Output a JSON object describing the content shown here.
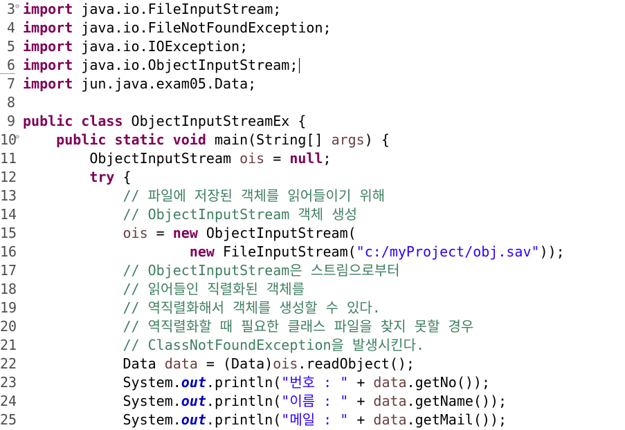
{
  "editor": {
    "lines": [
      {
        "num": "3",
        "fold": "⊖",
        "parts": [
          {
            "t": "import",
            "c": "kw"
          },
          {
            "t": " java.io.FileInputStream;",
            "c": ""
          }
        ]
      },
      {
        "num": "4",
        "fold": "",
        "parts": [
          {
            "t": "import",
            "c": "kw"
          },
          {
            "t": " java.io.FileNotFoundException;",
            "c": ""
          }
        ]
      },
      {
        "num": "5",
        "fold": "",
        "parts": [
          {
            "t": "import",
            "c": "kw"
          },
          {
            "t": " java.io.IOException;",
            "c": ""
          }
        ]
      },
      {
        "num": "6",
        "fold": "",
        "parts": [
          {
            "t": "import",
            "c": "kw"
          },
          {
            "t": " java.io.ObjectInputStream;",
            "c": ""
          }
        ]
      },
      {
        "num": "7",
        "fold": "",
        "parts": [
          {
            "t": "import",
            "c": "kw"
          },
          {
            "t": " jun.java.exam05.Data;",
            "c": ""
          }
        ]
      },
      {
        "num": "8",
        "fold": "",
        "parts": []
      },
      {
        "num": "9",
        "fold": "",
        "parts": [
          {
            "t": "public",
            "c": "kw"
          },
          {
            "t": " ",
            "c": ""
          },
          {
            "t": "class",
            "c": "kw"
          },
          {
            "t": " ObjectInputStreamEx {",
            "c": ""
          }
        ]
      },
      {
        "num": "10",
        "fold": "⊖",
        "parts": [
          {
            "t": "    ",
            "c": ""
          },
          {
            "t": "public",
            "c": "kw"
          },
          {
            "t": " ",
            "c": ""
          },
          {
            "t": "static",
            "c": "kw"
          },
          {
            "t": " ",
            "c": ""
          },
          {
            "t": "void",
            "c": "kw"
          },
          {
            "t": " main(String[] ",
            "c": ""
          },
          {
            "t": "args",
            "c": "var"
          },
          {
            "t": ") {",
            "c": ""
          }
        ]
      },
      {
        "num": "11",
        "fold": "",
        "parts": [
          {
            "t": "        ObjectInputStream ",
            "c": ""
          },
          {
            "t": "ois",
            "c": "var"
          },
          {
            "t": " = ",
            "c": ""
          },
          {
            "t": "null",
            "c": "kw"
          },
          {
            "t": ";",
            "c": ""
          }
        ]
      },
      {
        "num": "12",
        "fold": "",
        "parts": [
          {
            "t": "        ",
            "c": ""
          },
          {
            "t": "try",
            "c": "kw"
          },
          {
            "t": " {",
            "c": ""
          }
        ]
      },
      {
        "num": "13",
        "fold": "",
        "parts": [
          {
            "t": "            ",
            "c": ""
          },
          {
            "t": "// 파일에 저장된 객체를 읽어들이기 위해",
            "c": "cm"
          }
        ]
      },
      {
        "num": "14",
        "fold": "",
        "parts": [
          {
            "t": "            ",
            "c": ""
          },
          {
            "t": "// ObjectInputStream 객체 생성",
            "c": "cm"
          }
        ]
      },
      {
        "num": "15",
        "fold": "",
        "parts": [
          {
            "t": "            ",
            "c": ""
          },
          {
            "t": "ois",
            "c": "var"
          },
          {
            "t": " = ",
            "c": ""
          },
          {
            "t": "new",
            "c": "kw"
          },
          {
            "t": " ObjectInputStream(",
            "c": ""
          }
        ]
      },
      {
        "num": "16",
        "fold": "",
        "parts": [
          {
            "t": "                    ",
            "c": ""
          },
          {
            "t": "new",
            "c": "kw"
          },
          {
            "t": " FileInputStream(",
            "c": ""
          },
          {
            "t": "\"c:/myProject/obj.sav\"",
            "c": "str"
          },
          {
            "t": "));",
            "c": ""
          }
        ]
      },
      {
        "num": "17",
        "fold": "",
        "parts": [
          {
            "t": "            ",
            "c": ""
          },
          {
            "t": "// ObjectInputStream은 스트림으로부터",
            "c": "cm"
          }
        ]
      },
      {
        "num": "18",
        "fold": "",
        "parts": [
          {
            "t": "            ",
            "c": ""
          },
          {
            "t": "// 읽어들인 직렬화된 객체를",
            "c": "cm"
          }
        ]
      },
      {
        "num": "19",
        "fold": "",
        "parts": [
          {
            "t": "            ",
            "c": ""
          },
          {
            "t": "// 역직렬화해서 객체를 생성할 수 있다.",
            "c": "cm"
          }
        ]
      },
      {
        "num": "20",
        "fold": "",
        "parts": [
          {
            "t": "            ",
            "c": ""
          },
          {
            "t": "// 역직렬화할 때 필요한 클래스 파일을 찾지 못할 경우",
            "c": "cm"
          }
        ]
      },
      {
        "num": "21",
        "fold": "",
        "parts": [
          {
            "t": "            ",
            "c": ""
          },
          {
            "t": "// ClassNotFoundException을 발생시킨다.",
            "c": "cm"
          }
        ]
      },
      {
        "num": "22",
        "fold": "",
        "parts": [
          {
            "t": "            Data ",
            "c": ""
          },
          {
            "t": "data",
            "c": "var"
          },
          {
            "t": " = (Data)",
            "c": ""
          },
          {
            "t": "ois",
            "c": "var"
          },
          {
            "t": ".readObject();",
            "c": ""
          }
        ]
      },
      {
        "num": "23",
        "fold": "",
        "parts": [
          {
            "t": "            System.",
            "c": ""
          },
          {
            "t": "out",
            "c": "fld"
          },
          {
            "t": ".println(",
            "c": ""
          },
          {
            "t": "\"번호 : \"",
            "c": "str"
          },
          {
            "t": " + ",
            "c": ""
          },
          {
            "t": "data",
            "c": "var"
          },
          {
            "t": ".getNo());",
            "c": ""
          }
        ]
      },
      {
        "num": "24",
        "fold": "",
        "parts": [
          {
            "t": "            System.",
            "c": ""
          },
          {
            "t": "out",
            "c": "fld"
          },
          {
            "t": ".println(",
            "c": ""
          },
          {
            "t": "\"이름 : \"",
            "c": "str"
          },
          {
            "t": " + ",
            "c": ""
          },
          {
            "t": "data",
            "c": "var"
          },
          {
            "t": ".getName());",
            "c": ""
          }
        ]
      },
      {
        "num": "25",
        "fold": "",
        "parts": [
          {
            "t": "            System.",
            "c": ""
          },
          {
            "t": "out",
            "c": "fld"
          },
          {
            "t": ".println(",
            "c": ""
          },
          {
            "t": "\"메일 : \"",
            "c": "str"
          },
          {
            "t": " + ",
            "c": ""
          },
          {
            "t": "data",
            "c": "var"
          },
          {
            "t": ".getMail());",
            "c": ""
          }
        ]
      }
    ]
  },
  "colors": {
    "keyword": "#7f0055",
    "comment": "#3f7f5f",
    "string": "#2a00ff",
    "static_field": "#0000c0",
    "local_variable": "#6a3e3e",
    "line_number": "#4d4d4d"
  }
}
